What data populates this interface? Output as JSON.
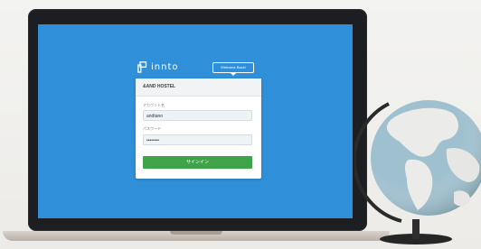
{
  "logo": {
    "text": "innto",
    "icon": "innto-logo-mark-icon"
  },
  "welcome_badge": {
    "label": "Welcome Back!"
  },
  "login_card": {
    "header": "&AND HOSTEL",
    "account_label": "アカウント名",
    "account_value": "andtano",
    "password_label": "パスワード",
    "password_value": "••••••••",
    "submit_label": "サインイン"
  },
  "colors": {
    "screen_bg": "#2f8fd9",
    "button_green": "#3fa349",
    "card_header_bg": "#f1f3f4"
  },
  "scene": {
    "globe": "globe-icon",
    "laptop": "laptop-icon"
  }
}
